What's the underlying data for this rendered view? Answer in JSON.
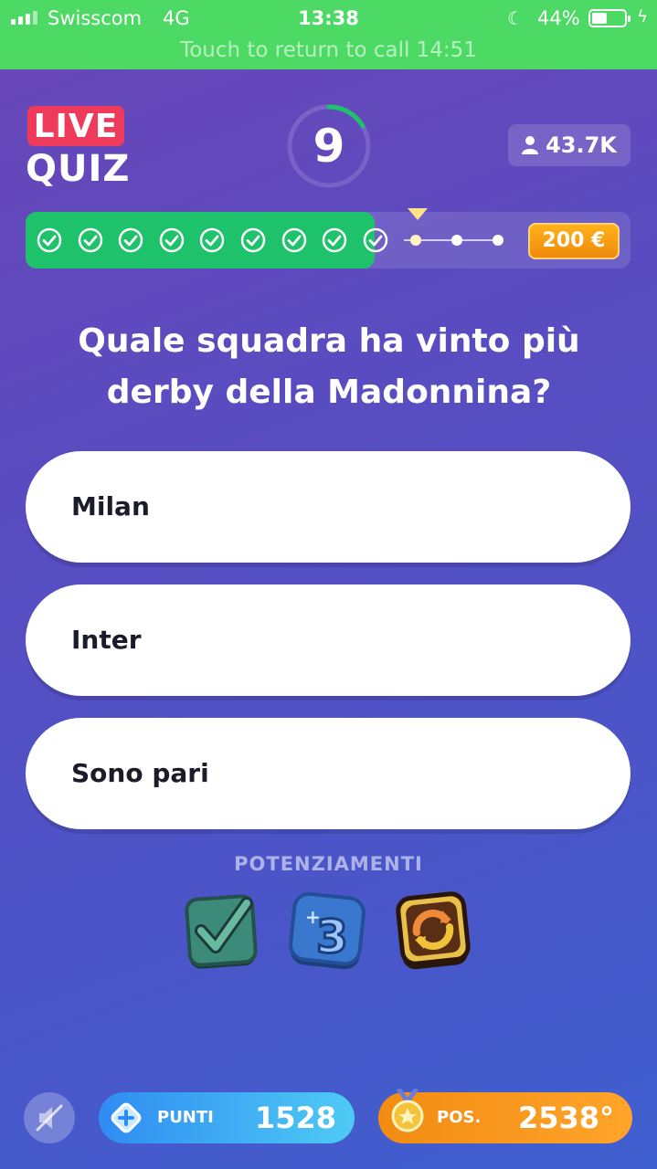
{
  "status_bar": {
    "carrier": "Swisscom",
    "network": "4G",
    "time": "13:38",
    "battery": "44%",
    "call_banner": "Touch to return to call 14:51"
  },
  "header": {
    "logo_top": "LIVE",
    "logo_bottom": "QUIZ",
    "timer": "9",
    "players": "43.7K"
  },
  "progress": {
    "answered_steps": 9,
    "remaining_steps": 3,
    "prize": "200 €"
  },
  "question": "Quale squadra ha vinto più derby della Madonnina?",
  "answers": [
    "Milan",
    "Inter",
    "Sono pari"
  ],
  "powerups": {
    "title": "POTENZIAMENTI",
    "items": [
      "check-icon",
      "plus-three-icon",
      "refresh-icon"
    ]
  },
  "footer": {
    "points_label": "PUNTI",
    "points_value": "1528",
    "position_label": "POS.",
    "position_value": "2538°"
  },
  "colors": {
    "status_green": "#4cd964",
    "progress_green": "#1ec26b",
    "live_red": "#ee3a5b",
    "prize_orange": "#f08a0c"
  }
}
